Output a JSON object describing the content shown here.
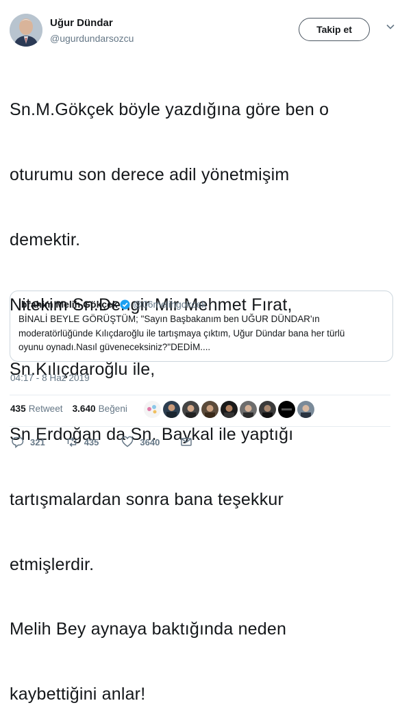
{
  "author": {
    "name": "Uğur Dündar",
    "handle": "@ugurdundarsozcu",
    "follow_label": "Takip et"
  },
  "tweet": {
    "lines": [
      "Sn.M.Gökçek böyle yazdığına göre ben o",
      "oturumu son derece adil yönetmişim",
      "demektir.",
      "Nitekim Sn.Dengir Mir Mehmet Fırat,",
      "Sn.Kılıçdaroğlu ile,",
      "Sn Erdoğan da Sn. Baykal ile yaptığı",
      "tartışmalardan sonra bana teşekkur",
      "etmişlerdir.",
      "Melih Bey aynaya baktığında neden",
      "kaybettiğini anlar!"
    ]
  },
  "quote": {
    "name": "İbrahim Melih Gökçek",
    "handle": "@06melihgokcek",
    "lines": [
      "BİNALİ BEYLE GÖRÜŞTÜM;  \"Sayın Başbakanım ben UĞUR DÜNDAR'ın",
      "moderatörlüğünde Kılıçdaroğlu ile tartışmaya çıktım, Uğur Dündar bana her türlü",
      "oyunu oynadı.Nasıl güveneceksiniz?\"DEDİM...."
    ]
  },
  "timestamp": "04:17 - 8 Haz 2019",
  "stats": {
    "retweets_count": "435",
    "retweets_label": "Retweet",
    "likes_count": "3.640",
    "likes_label": "Beğeni"
  },
  "actions": {
    "replies": "321",
    "retweets": "435",
    "likes": "3640"
  },
  "colors": {
    "text": "#14171a",
    "secondary": "#657786",
    "border": "#ccd6dd",
    "verified": "#1da1f2"
  },
  "icons": [
    "reply-icon",
    "retweet-icon",
    "heart-icon",
    "mail-icon",
    "chevron-down-icon",
    "verified-badge-icon"
  ]
}
